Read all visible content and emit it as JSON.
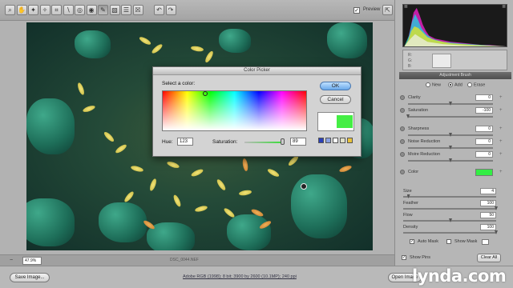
{
  "toolbar": {
    "tools": [
      {
        "icon": "zoom-icon",
        "glyph": "⌕"
      },
      {
        "icon": "hand-icon",
        "glyph": "✋"
      },
      {
        "icon": "white-balance-icon",
        "glyph": "✦"
      },
      {
        "icon": "color-sampler-icon",
        "glyph": "✧"
      },
      {
        "icon": "crop-icon",
        "glyph": "⌗"
      },
      {
        "icon": "straighten-icon",
        "glyph": "∖"
      },
      {
        "icon": "retouch-icon",
        "glyph": "◎"
      },
      {
        "icon": "red-eye-icon",
        "glyph": "◉"
      },
      {
        "icon": "adjustment-brush-icon",
        "glyph": "✎"
      },
      {
        "icon": "graduated-filter-icon",
        "glyph": "▧"
      },
      {
        "icon": "preferences-icon",
        "glyph": "☰"
      },
      {
        "icon": "trash-icon",
        "glyph": "☒"
      },
      {
        "icon": "rotate-left-icon",
        "glyph": "↶"
      },
      {
        "icon": "rotate-right-icon",
        "glyph": "↷"
      }
    ],
    "preview_label": "Preview",
    "preview_checked": "✓",
    "fullscreen_glyph": "⇱"
  },
  "zoom": {
    "value": "47.9%",
    "filename": "DSC_0044.NEF"
  },
  "bottom": {
    "save_label": "Save Image...",
    "workflow_text": "Adobe RGB (1998); 8 bit; 3900 by 2600 (10.1MP); 240 ppi",
    "open_label": "Open Image",
    "logo": "lynda.com"
  },
  "histogram": {
    "rgb_letters": [
      "R:",
      "G:",
      "B:"
    ]
  },
  "panel": {
    "title": "Adjustment Brush",
    "modes": [
      {
        "label": "New",
        "selected": false
      },
      {
        "label": "Add",
        "selected": true
      },
      {
        "label": "Erase",
        "selected": false
      }
    ],
    "sliders": [
      {
        "label": "Clarity",
        "value": "0",
        "position": 0.5
      },
      {
        "label": "Saturation",
        "value": "-100",
        "position": 0.0
      },
      {
        "label": "Sharpness",
        "value": "0",
        "position": 0.5
      },
      {
        "label": "Noise Reduction",
        "value": "0",
        "position": 0.5
      },
      {
        "label": "Moire Reduction",
        "value": "0",
        "position": 0.5
      }
    ],
    "color_label": "Color",
    "color_hex": "#33ee44",
    "options": [
      {
        "label": "Size",
        "value": "4",
        "position": 0.04
      },
      {
        "label": "Feather",
        "value": "100",
        "position": 1.0
      },
      {
        "label": "Flow",
        "value": "50",
        "position": 0.5
      },
      {
        "label": "Density",
        "value": "100",
        "position": 1.0
      }
    ],
    "auto_mask_label": "Auto Mask",
    "auto_mask_checked": "✓",
    "show_mask_label": "Show Mask",
    "show_pins_label": "Show Pins",
    "show_pins_checked": "✓",
    "clear_all_label": "Clear All"
  },
  "color_picker": {
    "title": "Color Picker",
    "select_label": "Select a color:",
    "ok_label": "OK",
    "cancel_label": "Cancel",
    "hue_label": "Hue:",
    "hue_value": "123",
    "saturation_label": "Saturation:",
    "saturation_value": "89",
    "saturation_fraction": 0.89,
    "new_color": "#44ee44",
    "swatches": [
      "#2a3fb8",
      "#8aa0e0",
      "#ffffff",
      "#e0e0c8",
      "#e8c23a"
    ]
  }
}
